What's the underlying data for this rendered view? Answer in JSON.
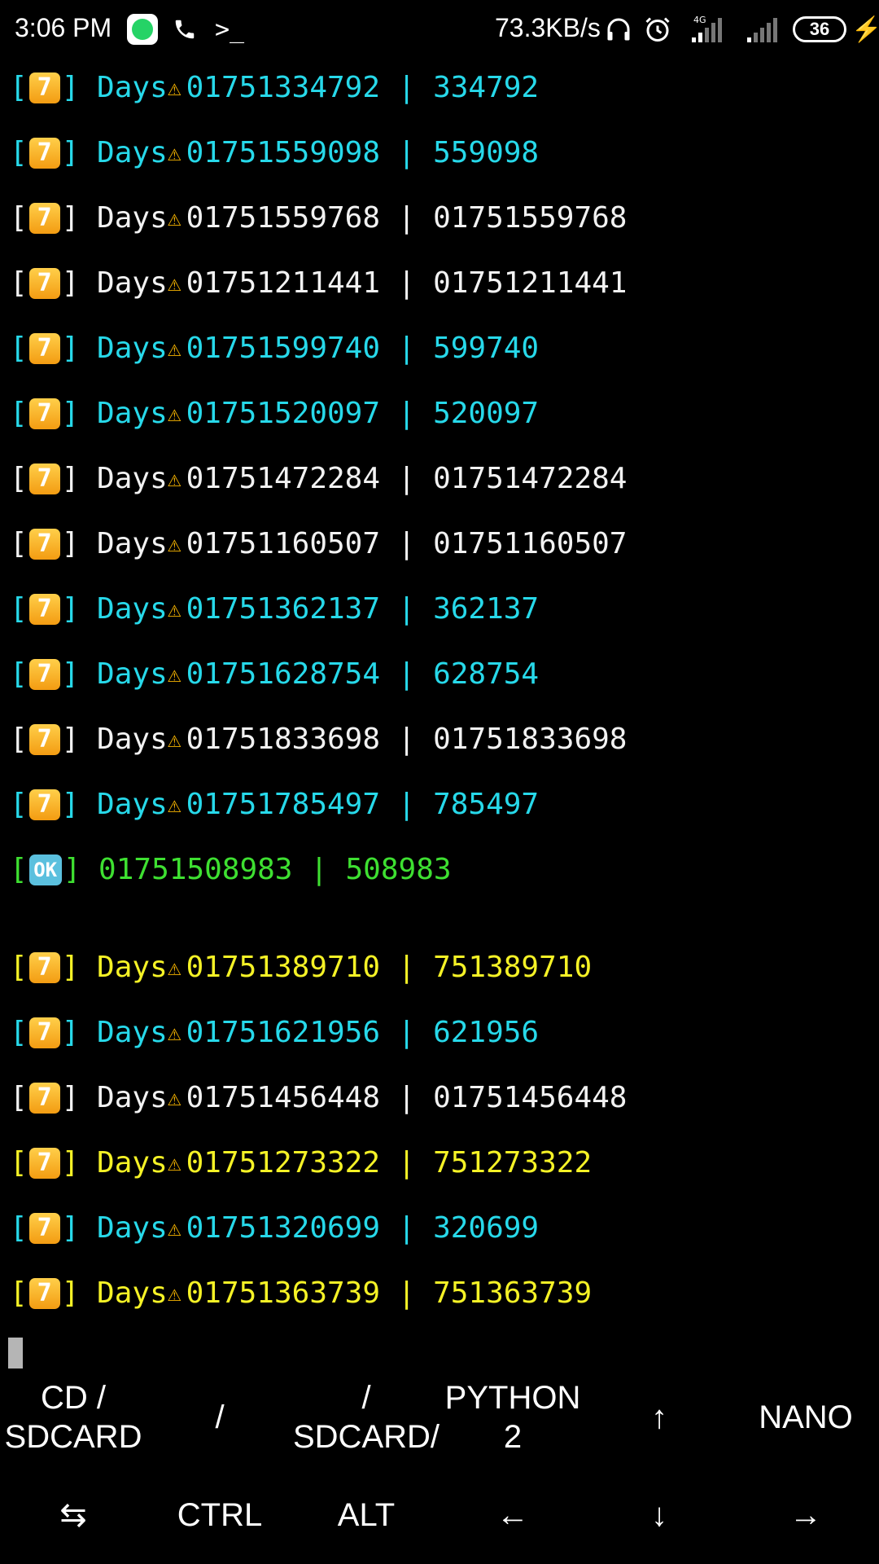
{
  "status_bar": {
    "time": "3:06 PM",
    "network_speed": "73.3KB/s",
    "network_type": "4G",
    "battery": "36",
    "icons": [
      "whatsapp-icon",
      "phone-icon",
      "terminal-icon",
      "headset-icon",
      "alarm-icon",
      "signal-icon",
      "signal-icon",
      "battery-icon",
      "charging-icon"
    ]
  },
  "terminal": {
    "lines": [
      {
        "badge": "7",
        "label": "Days",
        "number": "01751334792",
        "sep": "|",
        "pass": "334792",
        "color": "cyan"
      },
      {
        "badge": "7",
        "label": "Days",
        "number": "01751559098",
        "sep": "|",
        "pass": "559098",
        "color": "cyan"
      },
      {
        "badge": "7",
        "label": "Days",
        "number": "01751559768",
        "sep": "|",
        "pass": "01751559768",
        "color": "white"
      },
      {
        "badge": "7",
        "label": "Days",
        "number": "01751211441",
        "sep": "|",
        "pass": "01751211441",
        "color": "white"
      },
      {
        "badge": "7",
        "label": "Days",
        "number": "01751599740",
        "sep": "|",
        "pass": "599740",
        "color": "cyan"
      },
      {
        "badge": "7",
        "label": "Days",
        "number": "01751520097",
        "sep": "|",
        "pass": "520097",
        "color": "cyan"
      },
      {
        "badge": "7",
        "label": "Days",
        "number": "01751472284",
        "sep": "|",
        "pass": "01751472284",
        "color": "white"
      },
      {
        "badge": "7",
        "label": "Days",
        "number": "01751160507",
        "sep": "|",
        "pass": "01751160507",
        "color": "white"
      },
      {
        "badge": "7",
        "label": "Days",
        "number": "01751362137",
        "sep": "|",
        "pass": "362137",
        "color": "cyan"
      },
      {
        "badge": "7",
        "label": "Days",
        "number": "01751628754",
        "sep": "|",
        "pass": "628754",
        "color": "cyan"
      },
      {
        "badge": "7",
        "label": "Days",
        "number": "01751833698",
        "sep": "|",
        "pass": "01751833698",
        "color": "white"
      },
      {
        "badge": "7",
        "label": "Days",
        "number": "01751785497",
        "sep": "|",
        "pass": "785497",
        "color": "cyan"
      },
      {
        "badge": "OK",
        "label": "",
        "number": "01751508983",
        "sep": "|",
        "pass": "508983",
        "color": "green"
      },
      {
        "badge": "7",
        "label": "Days",
        "number": "01751389710",
        "sep": "|",
        "pass": "751389710",
        "color": "yellow"
      },
      {
        "badge": "7",
        "label": "Days",
        "number": "01751621956",
        "sep": "|",
        "pass": "621956",
        "color": "cyan"
      },
      {
        "badge": "7",
        "label": "Days",
        "number": "01751456448",
        "sep": "|",
        "pass": "01751456448",
        "color": "white"
      },
      {
        "badge": "7",
        "label": "Days",
        "number": "01751273322",
        "sep": "|",
        "pass": "751273322",
        "color": "yellow"
      },
      {
        "badge": "7",
        "label": "Days",
        "number": "01751320699",
        "sep": "|",
        "pass": "320699",
        "color": "cyan"
      },
      {
        "badge": "7",
        "label": "Days",
        "number": "01751363739",
        "sep": "|",
        "pass": "751363739",
        "color": "yellow"
      }
    ],
    "colors": {
      "cyan": "#27d9ea",
      "white": "#f2f2f2",
      "yellow": "#f5f226",
      "green": "#3ee031",
      "badge": "#f39c12",
      "ok_badge": "#5bc0de"
    }
  },
  "extra_keys": {
    "row1": [
      "CD /\nSDCARD",
      "/",
      "/\nSDCARD/",
      "PYTHON\n2",
      "↑",
      "NANO"
    ],
    "row2": [
      "⇆",
      "CTRL",
      "ALT",
      "←",
      "↓",
      "→"
    ]
  }
}
